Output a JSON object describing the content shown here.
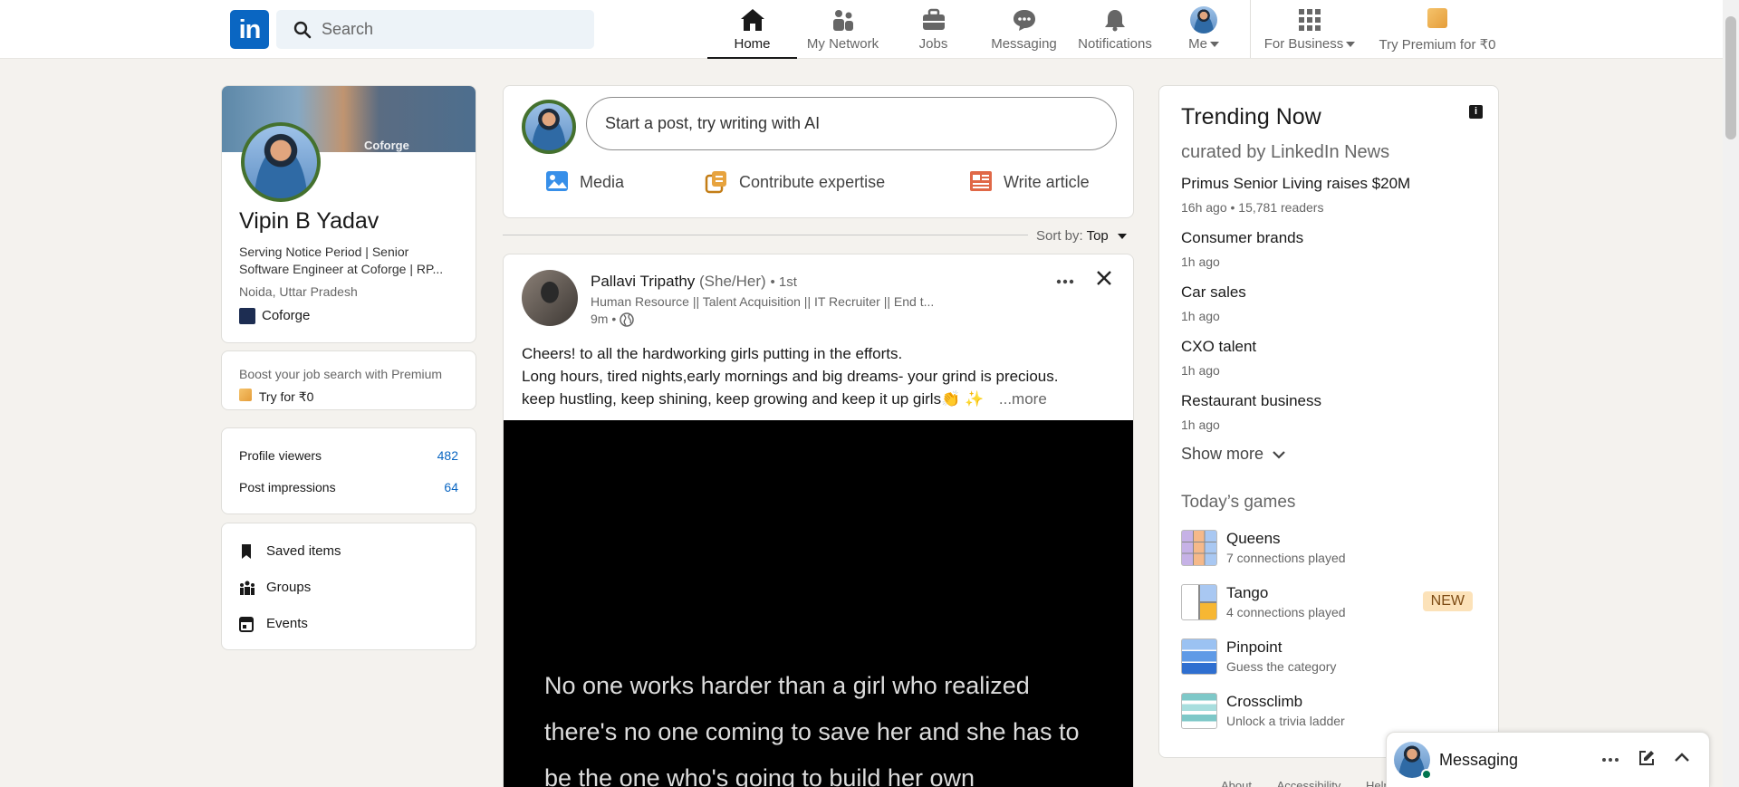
{
  "nav": {
    "search_placeholder": "Search",
    "items": [
      {
        "label": "Home",
        "icon": "home-icon"
      },
      {
        "label": "My Network",
        "icon": "network-icon"
      },
      {
        "label": "Jobs",
        "icon": "briefcase-icon"
      },
      {
        "label": "Messaging",
        "icon": "messaging-icon"
      },
      {
        "label": "Notifications",
        "icon": "bell-icon"
      },
      {
        "label": "Me",
        "icon": "avatar"
      },
      {
        "label": "For Business",
        "icon": "grid-icon"
      },
      {
        "label": "Try Premium for ₹0",
        "icon": "premium-icon"
      }
    ]
  },
  "profile": {
    "name": "Vipin B Yadav",
    "headline": "Serving Notice Period | Senior Software Engineer at Coforge | RP...",
    "location": "Noida, Uttar Pradesh",
    "company": "Coforge",
    "cover_text": "Coforge"
  },
  "premium_card": {
    "text": "Boost your job search with Premium",
    "cta": "Try for ₹0"
  },
  "stats": [
    {
      "label": "Profile viewers",
      "value": "482"
    },
    {
      "label": "Post impressions",
      "value": "64"
    }
  ],
  "left_menu": [
    {
      "label": "Saved items"
    },
    {
      "label": "Groups"
    },
    {
      "label": "Events"
    }
  ],
  "composer": {
    "placeholder": "Start a post, try writing with AI",
    "actions": [
      {
        "label": "Media"
      },
      {
        "label": "Contribute expertise"
      },
      {
        "label": "Write article"
      }
    ]
  },
  "sort": {
    "label": "Sort by:",
    "value": "Top"
  },
  "post": {
    "author": "Pallavi Tripathy",
    "pronouns": "(She/Her)",
    "degree": "• 1st",
    "headline": "Human Resource || Talent Acquisition || IT Recruiter || End t...",
    "time": "9m •",
    "text_line1": "Cheers! to all the hardworking girls putting in the efforts.",
    "text_line2": "Long hours, tired nights,early mornings and big dreams- your grind is precious.",
    "text_line3": "keep hustling, keep shining, keep growing and keep it up girls👏 ✨",
    "more": "...more",
    "video_text": "No one works harder than a girl who realized there's no one coming to save her and she has to be the one who's going to build her own"
  },
  "trending": {
    "title": "Trending Now",
    "subtitle": "curated by LinkedIn News",
    "items": [
      {
        "headline": "Primus Senior Living raises $20M",
        "meta": "16h ago • 15,781 readers"
      },
      {
        "headline": "Consumer brands",
        "meta": "1h ago"
      },
      {
        "headline": "Car sales",
        "meta": "1h ago"
      },
      {
        "headline": "CXO talent",
        "meta": "1h ago"
      },
      {
        "headline": "Restaurant business",
        "meta": "1h ago"
      }
    ],
    "show_more": "Show more"
  },
  "games": {
    "title": "Today’s games",
    "items": [
      {
        "name": "Queens",
        "sub": "7 connections played"
      },
      {
        "name": "Tango",
        "sub": "4 connections played",
        "badge": "NEW"
      },
      {
        "name": "Pinpoint",
        "sub": "Guess the category"
      },
      {
        "name": "Crossclimb",
        "sub": "Unlock a trivia ladder"
      }
    ]
  },
  "messaging": {
    "label": "Messaging"
  },
  "footer_links": [
    "About",
    "Accessibility",
    "Help"
  ]
}
